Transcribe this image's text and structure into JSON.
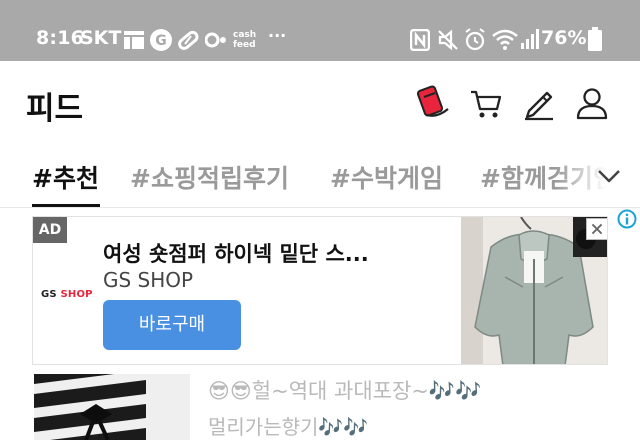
{
  "status_bar": {
    "time": "8:16",
    "carrier": "SKT",
    "cashfeed_line1": "cash",
    "cashfeed_line2": "feed",
    "overflow": "···",
    "battery_percent": "76%",
    "icons": [
      "notification-icon",
      "g-app-icon",
      "pill-icon",
      "dots-app-icon",
      "cashfeed-icon",
      "nfc-icon",
      "mute-icon",
      "alarm-icon",
      "wifi-icon",
      "signal-icon",
      "battery-icon"
    ]
  },
  "header": {
    "title": "피드",
    "icons": [
      "point-card-icon",
      "cart-icon",
      "pencil-icon",
      "profile-icon"
    ],
    "brand_color": "#e8253c"
  },
  "tabs": [
    {
      "label": "#추천",
      "active": true
    },
    {
      "label": "#쇼핑적립후기",
      "active": false
    },
    {
      "label": "#수박게임",
      "active": false
    },
    {
      "label": "#함께걷기인증",
      "active": false
    }
  ],
  "ad": {
    "badge": "AD",
    "logo_main": "GS ",
    "logo_accent": "SHOP",
    "title": "여성 숏점퍼 하이넥 밑단 스...",
    "brand": "GS SHOP",
    "button_label": "바로구매",
    "button_color": "#4a90e2"
  },
  "post": {
    "title": "😎😎헐~역대 과대포장~🎶🎶",
    "subtitle": "멀리가는향기🎶🎶"
  }
}
